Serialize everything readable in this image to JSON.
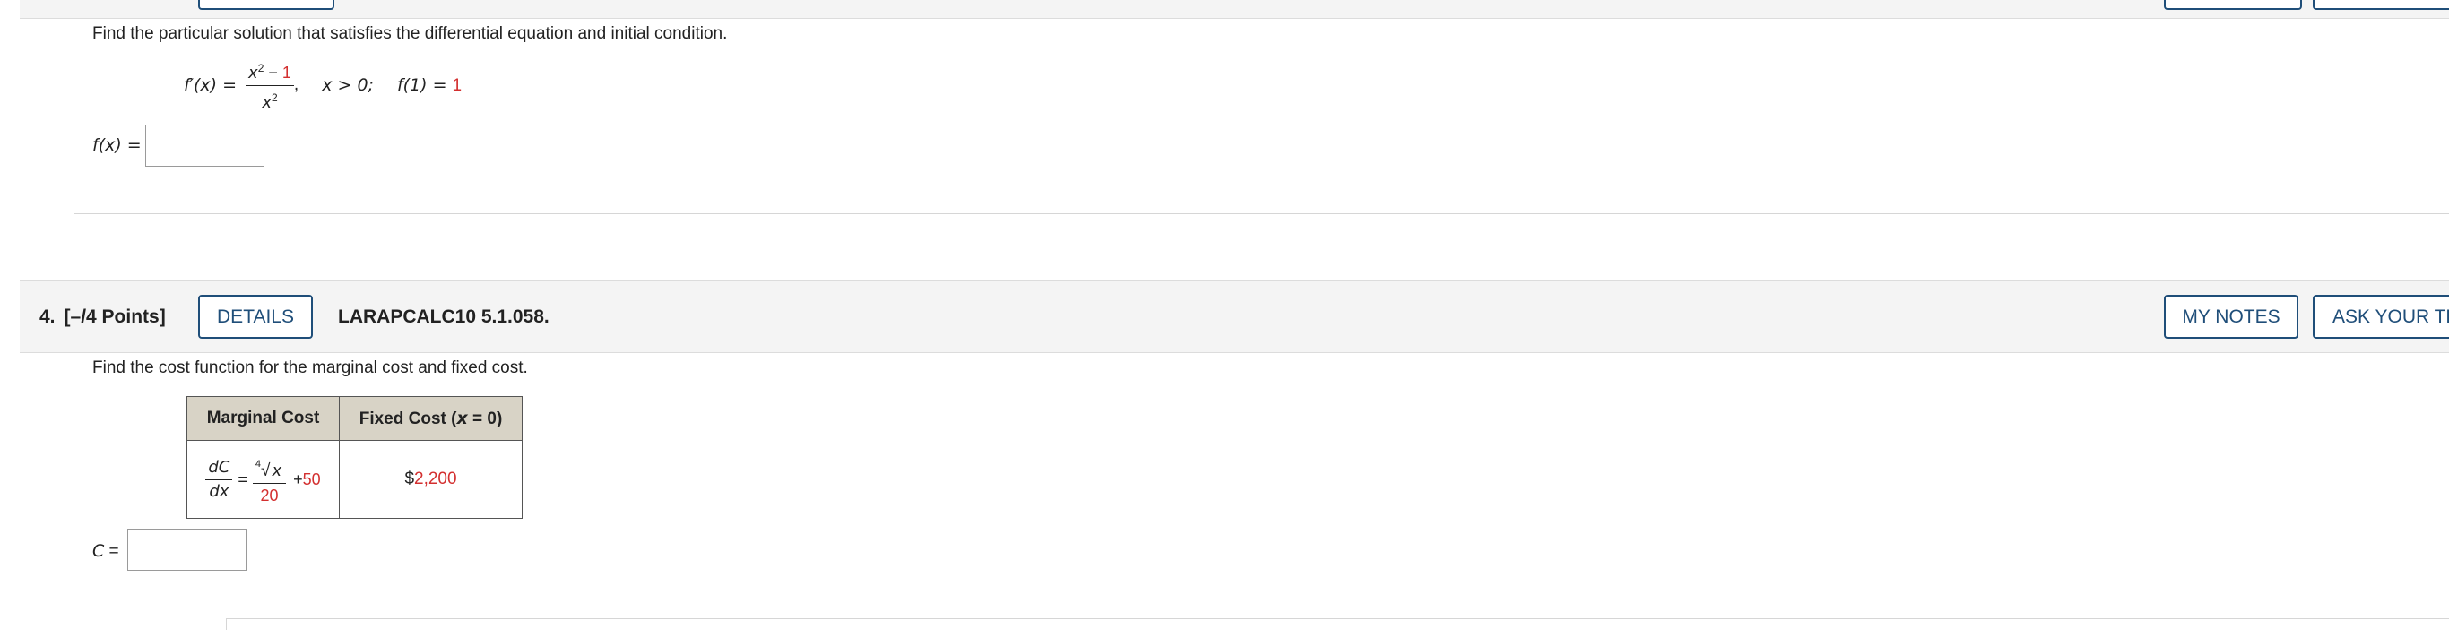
{
  "q3": {
    "prompt": "Find the particular solution that satisfies the differential equation and initial condition.",
    "lhs": "f′(x) =",
    "num_x2": "x",
    "num_sup": "2",
    "num_minus": " − ",
    "num_const": "1",
    "den_x": "x",
    "den_sup": "2",
    "comma": ",",
    "domain": "x > 0;",
    "init_lhs": "f(1) = ",
    "init_val": "1",
    "answer_label": "f(x) ="
  },
  "q4": {
    "number": "4.",
    "points": "[–/4 Points]",
    "details_label": "DETAILS",
    "source": "LARAPCALC10 5.1.058.",
    "my_notes_label": "MY NOTES",
    "ask_teacher_label": "ASK YOUR TEACHER",
    "prompt": "Find the cost function for the marginal cost and fixed cost.",
    "table": {
      "col1_header": "Marginal Cost",
      "col2_header_prefix": "Fixed Cost (",
      "col2_header_var": "x",
      "col2_header_suffix": " = 0)",
      "dc": "dC",
      "dx": "dx",
      "equals": "=",
      "root_index": "4",
      "root_var": "x",
      "denominator": "20",
      "plus": "+ ",
      "addend": "50",
      "fixed_dollar": "$",
      "fixed_value": "2,200"
    },
    "answer_label_var": "C",
    "answer_label_eq": " ="
  },
  "colors": {
    "accent": "#1f4e79",
    "highlight": "#d32f2f",
    "table_header_bg": "#d8d3c6",
    "header_bg": "#f4f4f4"
  }
}
